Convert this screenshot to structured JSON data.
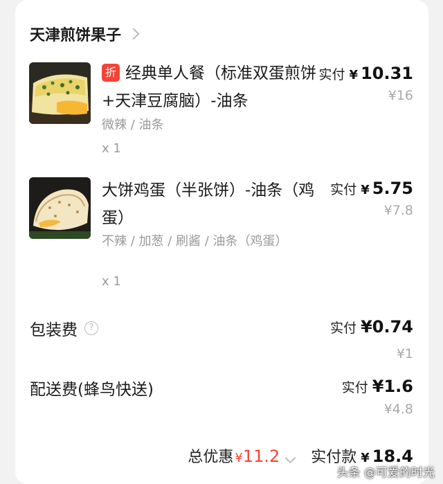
{
  "shop": {
    "name": "天津煎饼果子"
  },
  "items": [
    {
      "badge": "折",
      "title": "经典单人餐（标准双蛋煎饼+天津豆腐脑）-油条",
      "spec": "微辣 / 油条",
      "qty": "x 1",
      "paid_label": "实付",
      "currency": "¥",
      "paid_amount": "10.31",
      "original_price": "¥16"
    },
    {
      "title": "大饼鸡蛋（半张饼）-油条（鸡蛋）",
      "spec": "不辣 / 加葱 / 刷酱 / 油条（鸡蛋）",
      "qty": "x 1",
      "paid_label": "实付",
      "currency": "¥",
      "paid_amount": "5.75",
      "original_price": "¥7.8"
    }
  ],
  "fees": {
    "packaging": {
      "label": "包装费",
      "help_icon": "?",
      "paid_label": "实付",
      "paid_amount": "¥0.74",
      "original_price": "¥1"
    },
    "delivery": {
      "label": "配送费(蜂鸟快送)",
      "paid_label": "实付",
      "paid_amount": "¥1.6",
      "original_price": "¥4.8"
    }
  },
  "totals": {
    "discount_label": "总优惠",
    "discount_currency": "¥",
    "discount_amount": "11.2",
    "paid_label": "实付款",
    "paid_currency": "¥",
    "paid_amount": "18.4"
  },
  "watermark": {
    "text": "头条 @可爱的时光"
  },
  "colors": {
    "accent_red": "#f44336",
    "muted_text": "#9a9a9a",
    "card_bg": "#ffffff",
    "page_bg": "#f2f2f2"
  },
  "icons": {
    "shop_chevron": "chevron-right-icon",
    "help": "question-circle-icon",
    "discount_expand": "chevron-down-icon"
  }
}
